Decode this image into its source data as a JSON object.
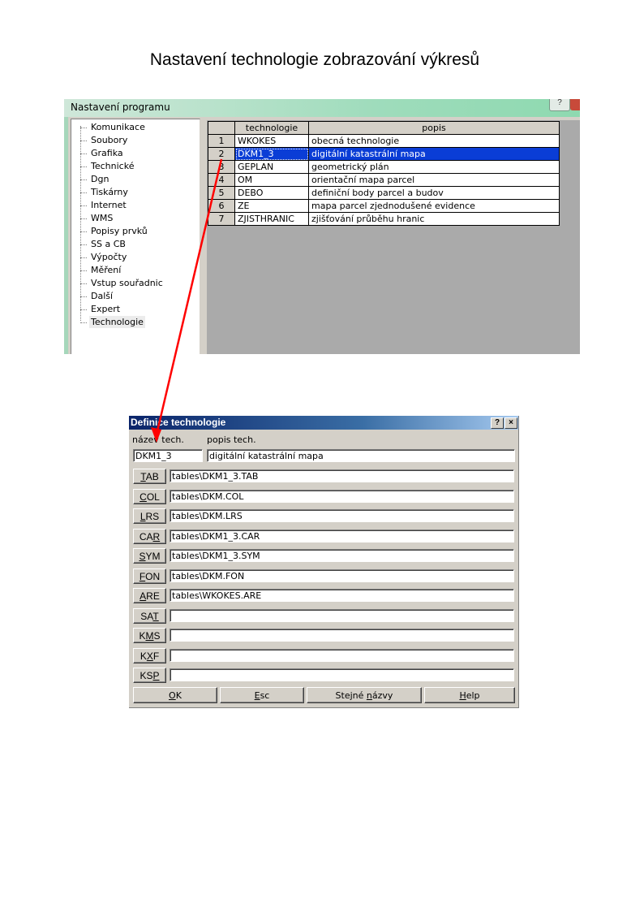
{
  "page_title": "Nastavení technologie zobrazování výkresů",
  "settings_window": {
    "title": "Nastavení programu",
    "help_label": "?",
    "tree_items": [
      "Komunikace",
      "Soubory",
      "Grafika",
      "Technické",
      "Dgn",
      "Tiskárny",
      "Internet",
      "WMS",
      "Popisy prvků",
      "SS a CB",
      "Výpočty",
      "Měření",
      "Vstup souřadnic",
      "Další",
      "Expert",
      "Technologie"
    ],
    "selected_tree_item": "Technologie",
    "grid_headers": [
      "technologie",
      "popis"
    ],
    "rows": [
      {
        "num": "1",
        "code": "WKOKES",
        "desc": "obecná technologie"
      },
      {
        "num": "2",
        "code": "DKM1_3",
        "desc": "digitální katastrální mapa"
      },
      {
        "num": "3",
        "code": "GEPLAN",
        "desc": "geometrický plán"
      },
      {
        "num": "4",
        "code": "OM",
        "desc": "orientační mapa parcel"
      },
      {
        "num": "5",
        "code": "DEBO",
        "desc": "definiční body parcel a budov"
      },
      {
        "num": "6",
        "code": "ZE",
        "desc": "mapa parcel zjednodušené evidence"
      },
      {
        "num": "7",
        "code": "ZJISTHRANIC",
        "desc": "zjišťování průběhu hranic"
      }
    ],
    "selected_row": "2"
  },
  "definition_dialog": {
    "title": "Definice technologie",
    "help_label": "?",
    "close_label": "×",
    "name_label": "název tech.",
    "desc_label": "popis tech.",
    "name_value": "DKM1_3",
    "desc_value": "digitální katastrální mapa",
    "files": [
      {
        "pre": "",
        "key": "T",
        "post": "AB",
        "value": "tables\\DKM1_3.TAB"
      },
      {
        "pre": "",
        "key": "C",
        "post": "OL",
        "value": "tables\\DKM.COL"
      },
      {
        "pre": "",
        "key": "L",
        "post": "RS",
        "value": "tables\\DKM.LRS"
      },
      {
        "pre": "CA",
        "key": "R",
        "post": "",
        "value": "tables\\DKM1_3.CAR"
      },
      {
        "pre": "",
        "key": "S",
        "post": "YM",
        "value": "tables\\DKM1_3.SYM"
      },
      {
        "pre": "",
        "key": "F",
        "post": "ON",
        "value": "tables\\DKM.FON"
      },
      {
        "pre": "",
        "key": "A",
        "post": "RE",
        "value": "tables\\WKOKES.ARE"
      },
      {
        "pre": "SA",
        "key": "T",
        "post": "",
        "value": ""
      },
      {
        "pre": "K",
        "key": "M",
        "post": "S",
        "value": ""
      },
      {
        "pre": "K",
        "key": "X",
        "post": "F",
        "value": ""
      },
      {
        "pre": "KS",
        "key": "P",
        "post": "",
        "value": ""
      }
    ],
    "footer_buttons": [
      {
        "pre": "",
        "key": "O",
        "post": "K"
      },
      {
        "pre": "",
        "key": "E",
        "post": "sc"
      },
      {
        "pre": "Stejné ",
        "key": "n",
        "post": "ázvy"
      },
      {
        "pre": "",
        "key": "H",
        "post": "elp"
      }
    ]
  },
  "colors": {
    "selection": "#0a3dd6",
    "arrow": "#ff0000",
    "dialog_title": "#0a246a"
  }
}
